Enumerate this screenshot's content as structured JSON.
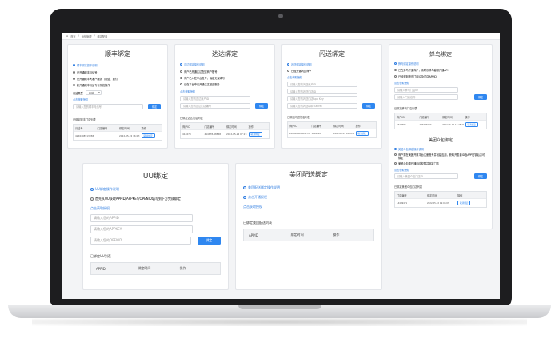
{
  "breadcrumb": {
    "home": "首页",
    "sep": "/",
    "level1": "运营管理",
    "level2": "绑定配置"
  },
  "sf": {
    "title": "顺丰绑定",
    "link1": "顺丰绑定操作说明",
    "options": [
      "已开通顺丰月结号",
      "已开通顺丰大客户服务（月结、到付）",
      "新开通顺丰月结专有系统操作"
    ],
    "select_label": "月结类型",
    "select_value": "月结",
    "apply_link": "点击获取授权",
    "input_placeholder": "请输入您的顺丰月结号",
    "bind": "绑定",
    "list_title": "已绑定顺丰门店列表",
    "cols": [
      "月结号",
      "门店编号",
      "绑定时间",
      "操作"
    ],
    "rows": [
      {
        "c1": "4256408913058",
        "c2": "",
        "c3": "2022-05-22 16:07:17",
        "op": "取消绑定"
      }
    ]
  },
  "dd": {
    "title": "达达绑定",
    "link1": "达达绑定操作说明",
    "options": [
      "商户已开通达达配送商户账号",
      "商户已入驻平台账号，确定无误填写",
      "已在平台申请开通达达配送服务"
    ],
    "apply_link": "点击获取授权",
    "input1": "请输入您的达达商户ID",
    "input2": "请输入您的达达门店编号",
    "bind": "绑定",
    "list_title": "已绑定达达门店列表",
    "cols": [
      "商户ID",
      "门店编号",
      "绑定时间",
      "操作"
    ],
    "rows": [
      {
        "c1": "414678",
        "c2": "414678-98868",
        "c3": "2022-05-22 07:17:08",
        "op": "取消绑定"
      }
    ]
  },
  "ss": {
    "title": "闪送绑定",
    "link1": "闪送绑定操作说明",
    "option": "已经开通闪送商户",
    "apply_link": "点击获取授权",
    "inputs": [
      "请输入您的闪送商户ID",
      "请输入您的闪送门店ID",
      "请输入您的闪送门店App Key",
      "请输入您的闪送App Secret"
    ],
    "bind": "绑定",
    "list_title": "已绑定闪送门店列表",
    "cols": [
      "商户ID",
      "门店编号",
      "绑定时间",
      "操作"
    ],
    "rows": [
      {
        "c1": "20000000000107137",
        "c2": "1984128",
        "c3": "2022-05-19 18:03:41",
        "op": "取消绑定"
      }
    ]
  },
  "fn": {
    "title": "蜂鸟绑定",
    "link1": "蜂鸟绑定操作说明",
    "options": [
      "已在蜂鸟开通商户，请联系蜂鸟客服开通API",
      "已经得到蜂鸟门店ID及门店APPID"
    ],
    "apply_link": "点击获取授权",
    "input1": "请输入蜂鸟门店ID",
    "input2": "请输入门店名称",
    "bind": "绑定",
    "list_title": "已绑定蜂鸟门店列表",
    "cols": [
      "商户ID",
      "门店编号",
      "绑定时间",
      "操作"
    ],
    "rows": [
      {
        "c1": "5527687",
        "c2": "274974680",
        "c3": "2022-05-22 14:25:29",
        "op": "取消绑定"
      }
    ]
  },
  "mtpt": {
    "title": "美团众包绑定",
    "link1": "美团众包绑定操作说明",
    "options": [
      "商户需在美团开放平台注册账号并创建应用，获取开发者ID及APP密钥后方可绑定",
      "美团众包需开通相应权限并绑定门店"
    ],
    "apply_link": "点击获取授权",
    "input": "请输入美团众包门店ID",
    "bind": "绑定",
    "list_title": "已绑定美团众包门店列表",
    "cols": [
      "门店编号",
      "绑定时间",
      "操作"
    ],
    "rows": [
      {
        "c1": "14489471",
        "c2": "2022-05-22 19:08:03",
        "op": "取消绑定"
      }
    ]
  },
  "uu": {
    "title": "UU绑定",
    "link1": "UU绑定操作说明",
    "option": "首先从UU获取APPID/APPKEY/OPENID填写到下方完成绑定",
    "apply_link": "点击获取授权",
    "inputs": [
      "请输入您的APPID",
      "请输入您的APPKEY",
      "请输入您的OPENID"
    ],
    "bind": "绑定",
    "list_title": "已绑定UU列表",
    "cols": [
      "APPID",
      "绑定时间",
      "操作"
    ]
  },
  "mt": {
    "title": "美团配送绑定",
    "link1": "美团配送绑定操作说明",
    "link2": "点击开通授权",
    "apply_link": "点击获取授权",
    "list_title": "已绑定美团配送列表",
    "cols": [
      "APPID",
      "绑定时间",
      "操作"
    ]
  }
}
